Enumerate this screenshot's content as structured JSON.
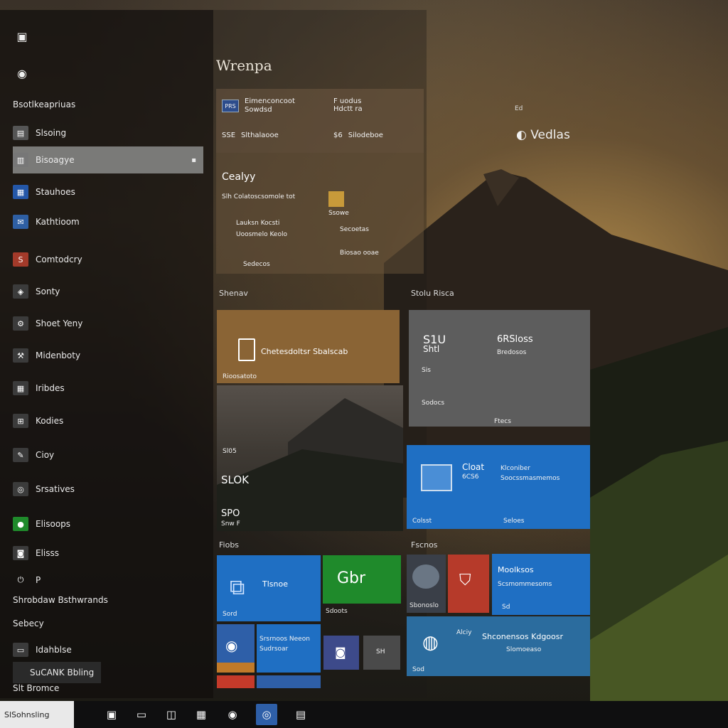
{
  "colors": {
    "accent_blue": "#1f6fc3",
    "tile_brown": "#8a6435",
    "tile_gray": "#5d5d5d",
    "tile_green": "#1f8a2b",
    "tile_red": "#b63a2a",
    "selected_bg": "#7a7a78"
  },
  "rail": {
    "top_icon": "windows-logo-icon",
    "user_icon": "user-icon"
  },
  "left_menu": {
    "header": "Bsotlkeapriuas",
    "items": [
      {
        "label": "Slsoing",
        "icon": "folder-icon",
        "color": "#555"
      },
      {
        "label": "Bisoagye",
        "icon": "document-icon",
        "color": "#777"
      },
      {
        "label": "Stauhoes",
        "icon": "photos-icon",
        "color": "#2457a8"
      },
      {
        "label": "Kathtioom",
        "icon": "mail-icon",
        "color": "#2e5fa3"
      },
      {
        "label": "Comtodcry",
        "icon": "app-icon",
        "color": "#a33a2a"
      },
      {
        "label": "Sonty",
        "icon": "store-icon",
        "color": "#3b3b3b"
      },
      {
        "label": "Shoet Yeny",
        "icon": "settings-icon",
        "color": "#3b3b3b"
      },
      {
        "label": "Midenboty",
        "icon": "tool-icon",
        "color": "#3b3b3b"
      },
      {
        "label": "Iribdes",
        "icon": "calendar-icon",
        "color": "#3b3b3b"
      },
      {
        "label": "Kodies",
        "icon": "grid-icon",
        "color": "#3b3b3b"
      },
      {
        "label": "Cioy",
        "icon": "chat-icon",
        "color": "#3b3b3b"
      },
      {
        "label": "Srsatives",
        "icon": "globe-icon",
        "color": "#3b3b3b"
      },
      {
        "label": "Elisoops",
        "icon": "xbox-icon",
        "color": "#1f8a2b"
      },
      {
        "label": "Elisss",
        "icon": "camera-icon",
        "color": "#3b3b3b"
      }
    ],
    "footer_items": [
      {
        "label": "P",
        "icon": "power-icon"
      },
      {
        "label": "Shrobdaw Bsthwrands"
      },
      {
        "label": "Sebecy"
      },
      {
        "label": "Idahblse",
        "icon": "monitor-icon"
      },
      {
        "label": "SuCANK Bbling"
      },
      {
        "label": "Slt Bromce"
      }
    ]
  },
  "main": {
    "title": "Wrenpa",
    "top_block": {
      "rows": [
        {
          "icon": "PRS",
          "line1": "Eimenconcoot",
          "line2": "Sowdsd"
        },
        {
          "icon": "",
          "line1": "",
          "line2": ""
        },
        {
          "icon": "SSE",
          "line1": "Slthalaooe"
        },
        {
          "icon": "$6",
          "line1": "Silodeboe"
        }
      ],
      "right_text_a": "F uodus",
      "right_text_b": "Hdctt ra",
      "corner_small": "Ed",
      "corner_title": "Vedlas"
    },
    "mid_block": {
      "title": "Cealyy",
      "lines": [
        "Slh Colatoscsomole tot"
      ],
      "rows_left": [
        "Lauksn Kocsti",
        "Uoosmelo Keolo",
        "Sedecos"
      ],
      "rows_right": [
        "Ssowe",
        "Secoetas",
        "Biosao ooae"
      ]
    },
    "sections": {
      "left": "Shenav",
      "right": "Stolu Risca",
      "bottom_left": "Fiobs",
      "bottom_right": "Fscnos"
    },
    "tiles": {
      "brown_wide": {
        "label": "Chetesdoltsr Sbalscab",
        "sub": "Rioosatoto"
      },
      "gray_large": {
        "a": "S1U",
        "b": "Shtl",
        "c": "6RSloss",
        "d": "Bredosos",
        "e": "Sis",
        "f": "Sodocs",
        "g": "Ftecs"
      },
      "photo_tile": {
        "a": "Sl05",
        "b": "SLOK",
        "c": "SPO",
        "d": "Snw F"
      },
      "blue_wide": {
        "a": "Cloat",
        "b": "6CS6",
        "c": "Klconiber",
        "d": "Soocssmasmemos",
        "e": "Colsst",
        "f": "Seloes"
      },
      "bottom": {
        "blue_a": {
          "label": "Tlsnoe",
          "sub": "Sord"
        },
        "green": {
          "label": "Gbr",
          "sub": "Sdoots"
        },
        "red_group": {
          "sub": "Sbonoslo"
        },
        "blue_b": {
          "label": "Moolksos",
          "sub": "Scsmommesoms",
          "tiny": "Sd"
        },
        "small_a": {
          "label": "Srsrnoos Neeon",
          "sub": "Sudrsoar"
        },
        "small_b": {
          "label": "SH"
        },
        "wide_c": {
          "a": "Alciy",
          "b": "Shconensos Kdgoosr",
          "c": "Slomoeaso",
          "d": "Sod"
        }
      }
    }
  },
  "taskbar": {
    "search_text": "SlSohnsling",
    "icons": [
      "file-explorer-icon",
      "window-icon",
      "app-icon",
      "store-icon",
      "browser-icon",
      "cortana-icon",
      "media-icon"
    ]
  }
}
